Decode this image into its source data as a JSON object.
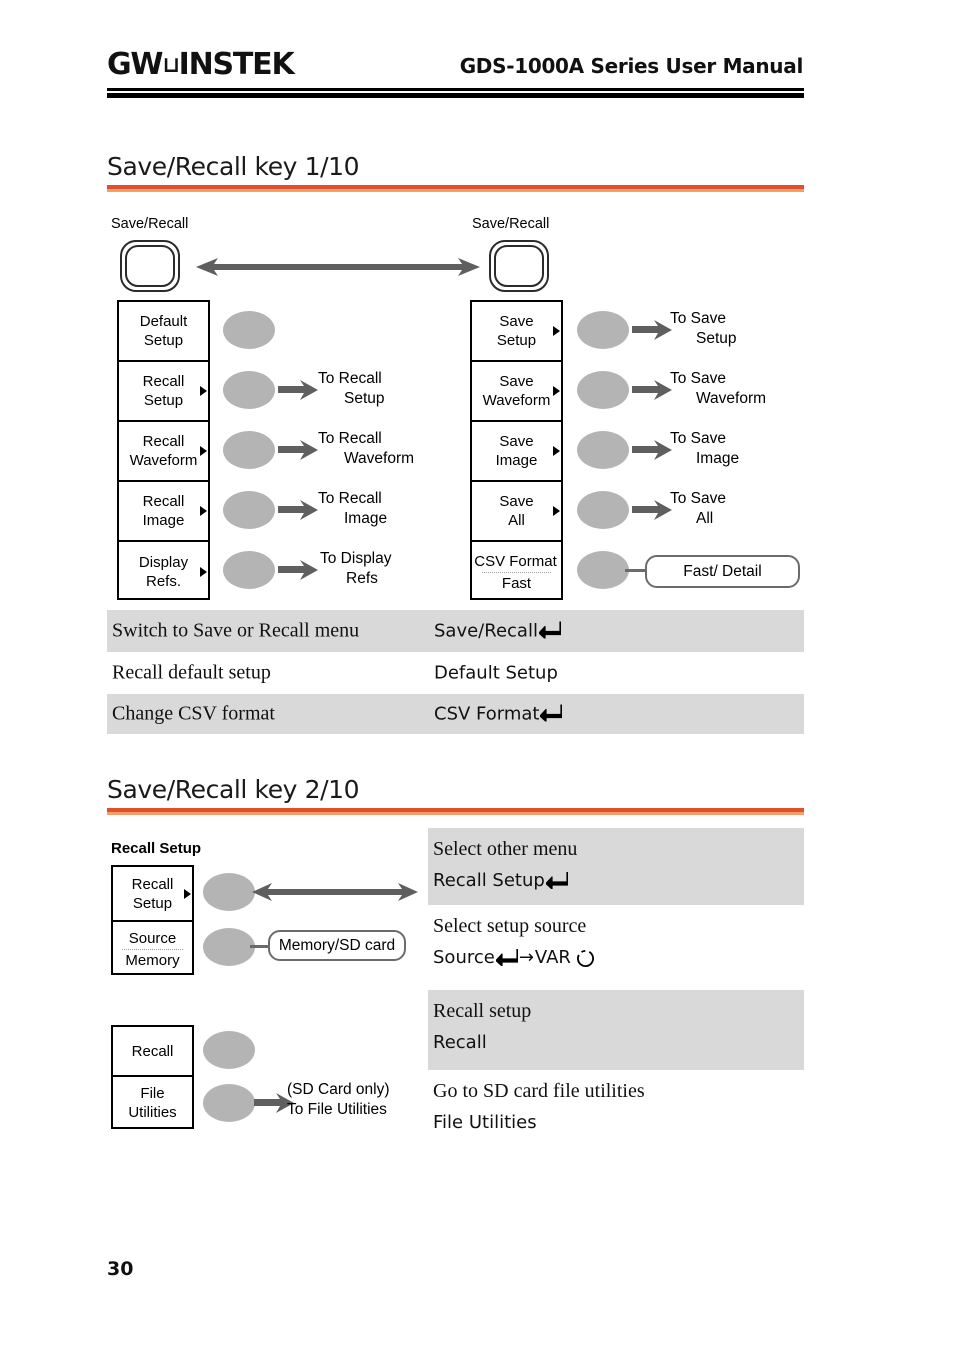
{
  "header": {
    "brand_gw": "GW",
    "brand_u": "⊔",
    "brand_instek": "INSTEK",
    "title": "GDS-1000A Series User Manual"
  },
  "page_number": "30",
  "sections": [
    {
      "title": "Save/Recall key 1/10",
      "diagram": {
        "left_key_label": "Save/Recall",
        "right_key_label": "Save/Recall",
        "left_menu": [
          {
            "line1": "Default",
            "line2": "Setup",
            "caret": false,
            "target": null
          },
          {
            "line1": "Recall",
            "line2": "Setup",
            "caret": true,
            "target": {
              "line1": "To Recall",
              "line2": "Setup"
            }
          },
          {
            "line1": "Recall",
            "line2": "Waveform",
            "caret": true,
            "target": {
              "line1": "To Recall",
              "line2": "Waveform"
            }
          },
          {
            "line1": "Recall",
            "line2": "Image",
            "caret": true,
            "target": {
              "line1": "To Recall",
              "line2": "Image"
            }
          },
          {
            "line1": "Display",
            "line2": "Refs.",
            "caret": true,
            "target": {
              "line1": "To Display",
              "line2": "Refs"
            }
          }
        ],
        "right_menu": [
          {
            "line1": "Save",
            "line2": "Setup",
            "caret": true,
            "target": {
              "line1": "To Save",
              "line2": "Setup"
            }
          },
          {
            "line1": "Save",
            "line2": "Waveform",
            "caret": true,
            "target": {
              "line1": "To Save",
              "line2": "Waveform"
            }
          },
          {
            "line1": "Save",
            "line2": "Image",
            "caret": true,
            "target": {
              "line1": "To Save",
              "line2": "Image"
            }
          },
          {
            "line1": "Save",
            "line2": "All",
            "caret": true,
            "target": {
              "line1": "To Save",
              "line2": "All"
            }
          },
          {
            "line1": "CSV Format",
            "line2": "Fast",
            "dotted": true,
            "caret": false,
            "pill": "Fast/ Detail"
          }
        ]
      },
      "rows": [
        {
          "left": "Switch to Save or Recall menu",
          "right": "Save/Recall",
          "enter": true,
          "shaded": true
        },
        {
          "left": "Recall default setup",
          "right": "Default Setup",
          "enter": false,
          "shaded": false
        },
        {
          "left": "Change CSV format",
          "right": "CSV Format",
          "enter": true,
          "shaded": true
        }
      ]
    },
    {
      "title": "Save/Recall key 2/10",
      "diagram": {
        "group_label": "Recall Setup",
        "menu_top": [
          {
            "line1": "Recall",
            "line2": "Setup",
            "caret": true
          },
          {
            "line1": "Source",
            "line2": "Memory",
            "dotted": true,
            "caret": false,
            "pill": "Memory/SD card"
          }
        ],
        "menu_bottom": [
          {
            "line1": "Recall",
            "line2": "",
            "caret": false
          },
          {
            "line1": "File",
            "line2": "Utilities",
            "caret": false,
            "target": {
              "line1": "(SD Card only)",
              "line2": "To File Utilities"
            }
          }
        ]
      },
      "rows": [
        {
          "title": "Select other menu",
          "sub": "Recall Setup",
          "enter": true,
          "var": false,
          "shaded": true
        },
        {
          "title": "Select setup source",
          "sub": "Source",
          "enter": true,
          "var": true,
          "var_label": "VAR",
          "shaded": false
        },
        {
          "title": "Recall setup",
          "sub": "Recall",
          "enter": false,
          "var": false,
          "shaded": true
        },
        {
          "title": "Go to SD card file utilities",
          "sub": "File Utilities",
          "enter": false,
          "var": false,
          "shaded": false
        }
      ]
    }
  ],
  "colors": {
    "rule_dark": "#e2502a",
    "rule_light": "#f0a068",
    "row_shade": "#d9d9d9",
    "knob_gray": "#b4b4b4",
    "arrow_gray": "#6b6b6b"
  }
}
